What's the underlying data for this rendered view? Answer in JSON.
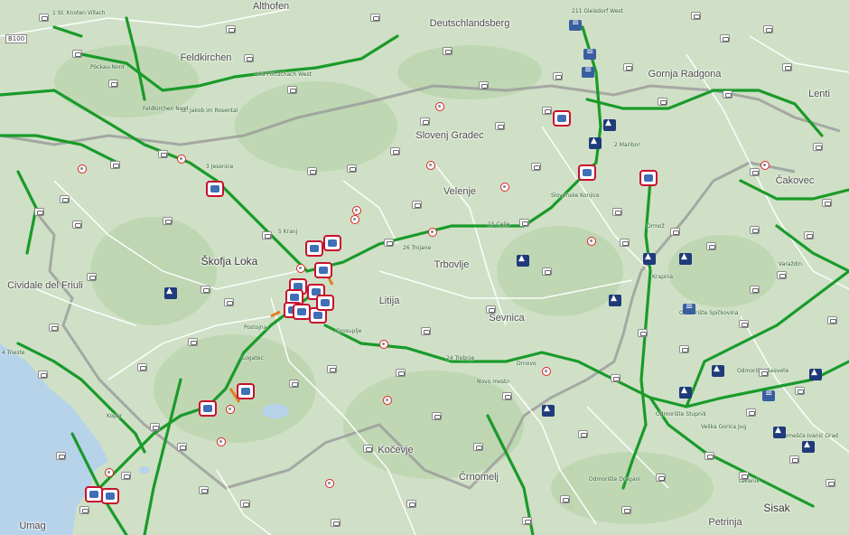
{
  "map": {
    "colors": {
      "land": "#cfe0c6",
      "sea": "#b7d3ea",
      "forest": "#bdd6b0",
      "road": "#1a9a2a",
      "minor_road": "#ffffff",
      "border": "#9a9a9a"
    },
    "places": [
      {
        "id": "althofen",
        "label": "Althofen"
      },
      {
        "id": "deutschlandsberg",
        "label": "Deutschlandsberg"
      },
      {
        "id": "feldkirchen",
        "label": "Feldkirchen"
      },
      {
        "id": "gornja-radgona",
        "label": "Gornja Radgona"
      },
      {
        "id": "lenti",
        "label": "Lenti"
      },
      {
        "id": "slovenj-gradec",
        "label": "Slovenj Gradec"
      },
      {
        "id": "velenje",
        "label": "Velenje"
      },
      {
        "id": "cakovec",
        "label": "Čakovec"
      },
      {
        "id": "skofja-loka",
        "label": "Škofja Loka"
      },
      {
        "id": "trbovlje",
        "label": "Trbovlje"
      },
      {
        "id": "cividale",
        "label": "Cividale del Friuli"
      },
      {
        "id": "sevnica",
        "label": "Sevnica"
      },
      {
        "id": "litija",
        "label": "Litija"
      },
      {
        "id": "kocevje",
        "label": "Kočevje"
      },
      {
        "id": "crnomelj",
        "label": "Črnomelj"
      },
      {
        "id": "sisak",
        "label": "Sisak"
      },
      {
        "id": "petrinja",
        "label": "Petrinja"
      },
      {
        "id": "umag",
        "label": "Umag"
      }
    ],
    "road_labels": [
      {
        "id": "b100",
        "label": "B100"
      }
    ],
    "junctions": [
      {
        "id": "j1",
        "label": "1 St. Knoten Villach"
      },
      {
        "id": "j2",
        "label": "211 Gleisdorf West"
      },
      {
        "id": "j3",
        "label": "Feldkirchen Nord"
      },
      {
        "id": "j4",
        "label": "St. Jakob im Rosental"
      },
      {
        "id": "j5",
        "label": "Pöckau-Nord"
      },
      {
        "id": "j6",
        "label": "263 Pörtschach West"
      },
      {
        "id": "j7",
        "label": "2 Maribor"
      },
      {
        "id": "j8",
        "label": "3 Jesenice"
      },
      {
        "id": "j9",
        "label": "5 Kranj"
      },
      {
        "id": "j10",
        "label": "15 Celje"
      },
      {
        "id": "j11",
        "label": "26 Trojane"
      },
      {
        "id": "j12",
        "label": "Slovenske Konjice"
      },
      {
        "id": "j13",
        "label": "Ormož"
      },
      {
        "id": "j14",
        "label": "Drnovo"
      },
      {
        "id": "j15",
        "label": "Postojna"
      },
      {
        "id": "j16",
        "label": "Logatec"
      },
      {
        "id": "j17",
        "label": "Grosuplje"
      },
      {
        "id": "j18",
        "label": "24 Trebnje"
      },
      {
        "id": "j19",
        "label": "Novo mesto"
      },
      {
        "id": "j20",
        "label": "Koper"
      },
      {
        "id": "j21",
        "label": "Odmorište Sesvete"
      },
      {
        "id": "j22",
        "label": "Odmorište Stupnik"
      },
      {
        "id": "j23",
        "label": "Velika Gorica Jug"
      },
      {
        "id": "j24",
        "label": "Odmorište Dragani"
      },
      {
        "id": "j25",
        "label": "Krapina"
      },
      {
        "id": "j26",
        "label": "Odmorište Spičkovina"
      },
      {
        "id": "j27",
        "label": "4 Trieste"
      },
      {
        "id": "j28",
        "label": "Bremešće Ivanić Grad"
      },
      {
        "id": "j29",
        "label": "Lekenik"
      },
      {
        "id": "j30",
        "label": "Varaždin"
      }
    ]
  }
}
